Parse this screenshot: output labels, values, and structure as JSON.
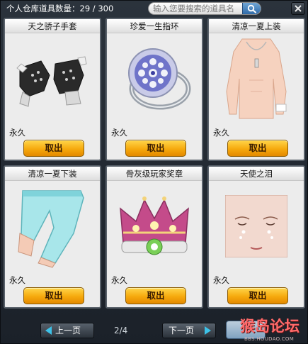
{
  "header": {
    "count_label": "个人仓库道具数量：29 / 300",
    "search_placeholder": "输入您要搜索的道具名"
  },
  "items": [
    {
      "title": "天之骄子手套",
      "duration": "永久",
      "button": "取出",
      "icon": "fingerless-gloves-icon"
    },
    {
      "title": "珍爱一生指环",
      "duration": "永久",
      "button": "取出",
      "icon": "diamond-ring-icon"
    },
    {
      "title": "清凉一夏上装",
      "duration": "永久",
      "button": "取出",
      "icon": "bare-torso-top-icon"
    },
    {
      "title": "清凉一夏下装",
      "duration": "永久",
      "button": "取出",
      "icon": "cyan-pants-icon"
    },
    {
      "title": "骨灰级玩家奖章",
      "duration": "永久",
      "button": "取出",
      "icon": "crown-medal-icon"
    },
    {
      "title": "天使之泪",
      "duration": "永久",
      "button": "取出",
      "icon": "angel-tears-face-icon"
    }
  ],
  "footer": {
    "prev_label": "上一页",
    "next_label": "下一页",
    "page_indicator": "2/4"
  },
  "watermark": {
    "text": "猴岛论坛",
    "url": "BBS.HOUDAO.COM"
  },
  "colors": {
    "accent_button": "#f6a90d",
    "nav_arrow": "#3dc2e8",
    "panel_bg": "#2b333c"
  }
}
